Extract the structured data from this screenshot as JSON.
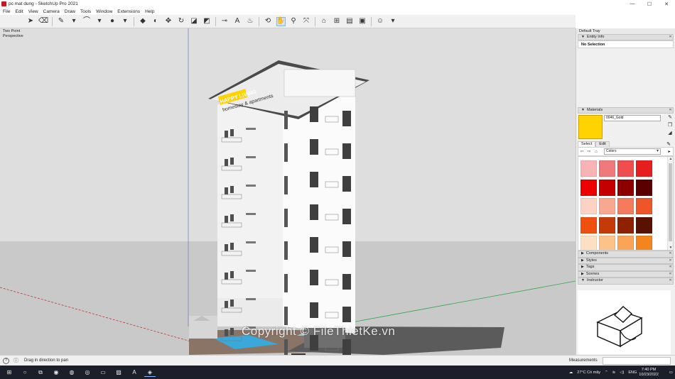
{
  "window": {
    "title": "pc mat dung - SketchUp Pro 2021",
    "minimize": "—",
    "maximize": "☐",
    "close": "✕"
  },
  "menu": [
    "File",
    "Edit",
    "View",
    "Camera",
    "Draw",
    "Tools",
    "Window",
    "Extensions",
    "Help"
  ],
  "toolbar": {
    "tools": [
      {
        "name": "select-tool",
        "glyph": "➤"
      },
      {
        "name": "eraser-tool",
        "glyph": "⌫"
      },
      {
        "name": "line-tool",
        "glyph": "✎"
      },
      {
        "name": "line-dropdown",
        "glyph": "▾"
      },
      {
        "name": "arc-tool",
        "glyph": "⌒"
      },
      {
        "name": "arc-dropdown",
        "glyph": "▾"
      },
      {
        "name": "shape-tool",
        "glyph": "●"
      },
      {
        "name": "shape-dropdown",
        "glyph": "▾"
      },
      {
        "name": "push-pull-tool",
        "glyph": "◆"
      },
      {
        "name": "follow-me-tool",
        "glyph": "◐"
      },
      {
        "name": "move-tool",
        "glyph": "✥"
      },
      {
        "name": "rotate-tool",
        "glyph": "↻"
      },
      {
        "name": "scale-tool",
        "glyph": "◪"
      },
      {
        "name": "offset-tool",
        "glyph": "◩"
      },
      {
        "name": "tape-measure-tool",
        "glyph": "⊸"
      },
      {
        "name": "text-tool",
        "glyph": "A"
      },
      {
        "name": "paint-bucket-tool",
        "glyph": "♨"
      },
      {
        "name": "orbit-tool",
        "glyph": "⟲"
      },
      {
        "name": "pan-tool",
        "glyph": "✋"
      },
      {
        "name": "zoom-tool",
        "glyph": "⚲"
      },
      {
        "name": "zoom-extents-tool",
        "glyph": "⤧"
      },
      {
        "name": "warehouse-tool",
        "glyph": "⌂"
      },
      {
        "name": "extension-warehouse-tool",
        "glyph": "⊞"
      },
      {
        "name": "layout-tool",
        "glyph": "▤"
      },
      {
        "name": "extension-manager-tool",
        "glyph": "▣"
      },
      {
        "name": "account-tool",
        "glyph": "☺"
      },
      {
        "name": "account-dropdown",
        "glyph": "▾"
      }
    ]
  },
  "viewport": {
    "view_label": [
      "Two Point",
      "Perspective"
    ],
    "sign_line1": "HAPPY LIVING",
    "sign_line2": "homestay & apartments",
    "watermark": "Copyright © FileThietKe.vn",
    "colors": {
      "ground": "#c9c9c9",
      "sky": "#dedede",
      "facade": "#f5f5f5",
      "sign": "#ffd200",
      "pool": "#3aa8d8",
      "green_axis": "#2fa84a",
      "red_axis": "#c83232",
      "blue_axis": "#3c4ad8"
    }
  },
  "tray": {
    "title": "Default Tray",
    "entity_info": {
      "header": "Entity Info",
      "value": "No Selection"
    },
    "materials": {
      "header": "Materials",
      "name": "0046_Gold",
      "swatch_color": "#ffd200",
      "tabs": [
        "Select",
        "Edit"
      ],
      "collection": "Colors",
      "swatches": [
        "#f8b4b4",
        "#f07a7a",
        "#ee4e4e",
        "#e61e1e",
        "#ee0000",
        "#c40000",
        "#8e0000",
        "#5a0000",
        "#fcd2c2",
        "#f8a890",
        "#f47c5c",
        "#ee5528",
        "#ef5010",
        "#c43a08",
        "#8e2200",
        "#5a1200",
        "#fde0c4",
        "#fbc28a",
        "#f9a456",
        "#f4841e",
        "#f08a00",
        "#c46a00",
        "#8e4c00",
        "#5a3000"
      ]
    },
    "panels": [
      "Components",
      "Styles",
      "Tags",
      "Scenes",
      "Instructor"
    ]
  },
  "statusbar": {
    "hint": "Drag in direction to pan",
    "measurements_label": "Measurements",
    "measurements_value": ""
  },
  "taskbar": {
    "apps": [
      {
        "name": "start-button",
        "glyph": "⊞"
      },
      {
        "name": "search-button",
        "glyph": "○"
      },
      {
        "name": "task-view-button",
        "glyph": "⧉"
      },
      {
        "name": "messenger-app",
        "glyph": "◉"
      },
      {
        "name": "chrome-app",
        "glyph": "◍"
      },
      {
        "name": "zoom-app",
        "glyph": "◎"
      },
      {
        "name": "file-explorer-app",
        "glyph": "▭"
      },
      {
        "name": "photos-app",
        "glyph": "▨"
      },
      {
        "name": "autocad-app",
        "glyph": "A"
      },
      {
        "name": "sketchup-app",
        "glyph": "◈"
      }
    ],
    "weather": "27°C  Có mây",
    "language": "ENG",
    "time": "7:40 PM",
    "date": "10/23/2022"
  }
}
